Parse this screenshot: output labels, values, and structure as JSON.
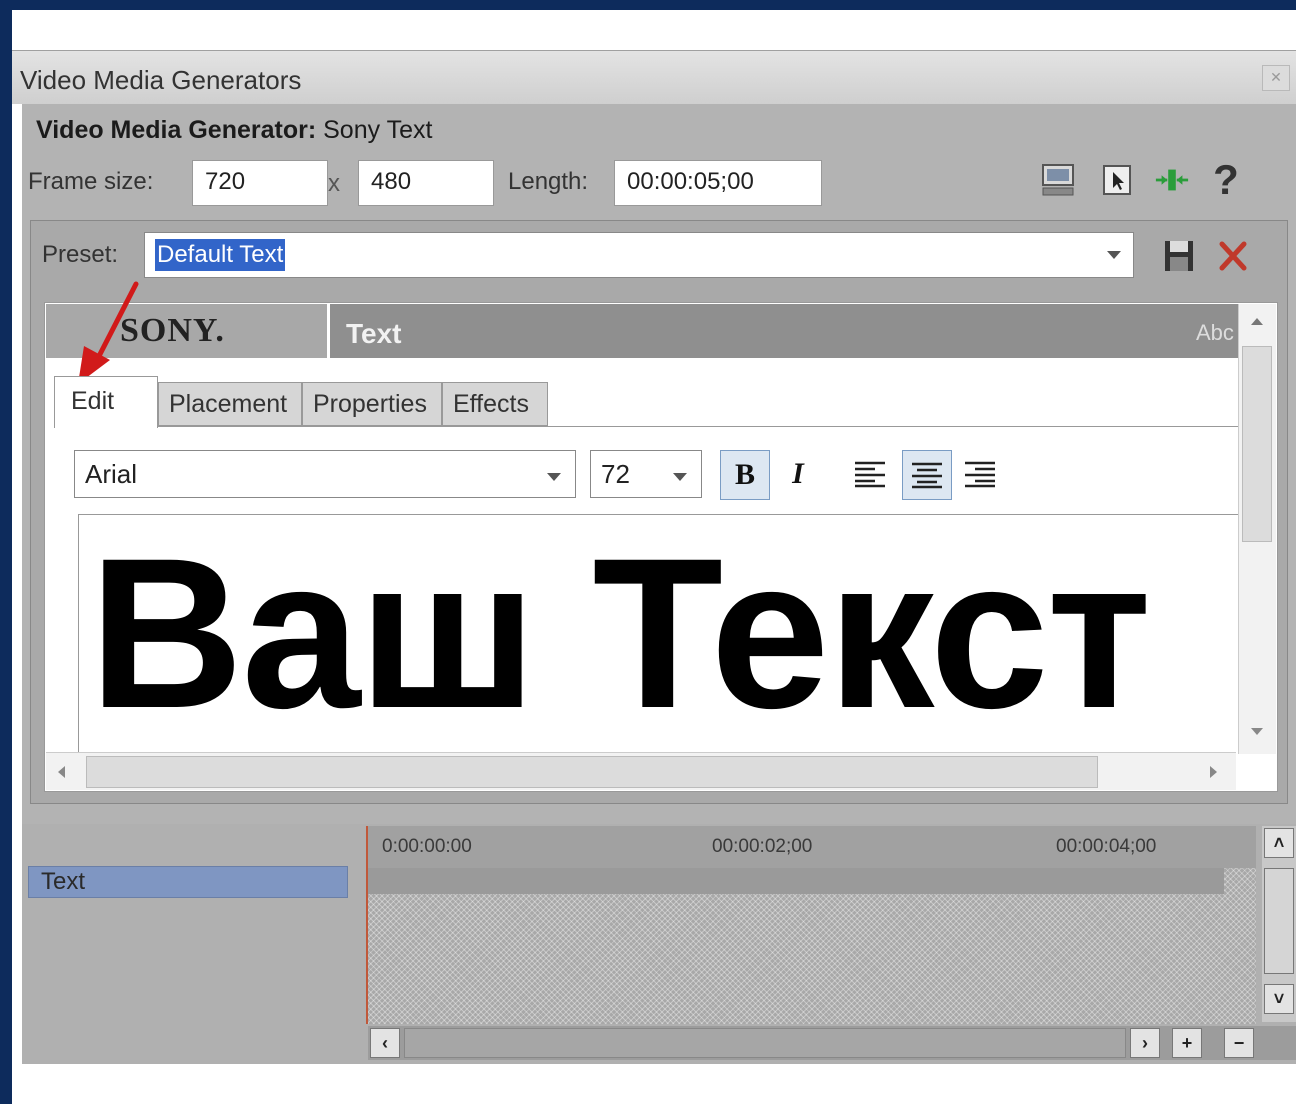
{
  "window": {
    "title": "Video Media Generators"
  },
  "generator": {
    "label": "Video Media Generator:",
    "name": "Sony Text"
  },
  "frame": {
    "label": "Frame size:",
    "width": "720",
    "sep": "x",
    "height": "480"
  },
  "length": {
    "label": "Length:",
    "value": "00:00:05;00"
  },
  "toolbar": {
    "help_label": "?"
  },
  "preset": {
    "label": "Preset:",
    "value": "Default Text"
  },
  "plugin": {
    "brand": "SONY.",
    "title": "Text",
    "abc": "Abc"
  },
  "tabs": [
    {
      "label": "Edit",
      "active": true
    },
    {
      "label": "Placement",
      "active": false
    },
    {
      "label": "Properties",
      "active": false
    },
    {
      "label": "Effects",
      "active": false
    }
  ],
  "format": {
    "font": "Arial",
    "size": "72",
    "bold_label": "B",
    "italic_label": "I"
  },
  "content": {
    "text": "Ваш Текст"
  },
  "timeline": {
    "track_name": "Text",
    "ticks": [
      "0:00:00:00",
      "00:00:02;00",
      "00:00:04;00"
    ]
  },
  "icons": [
    "monitor-icon",
    "cursor-select-icon",
    "sync-icon",
    "help-icon",
    "save-icon",
    "delete-icon"
  ],
  "colors": {
    "selection": "#3265c9",
    "arrow": "#d11a1a",
    "track_label_bg": "#7f96c2"
  }
}
